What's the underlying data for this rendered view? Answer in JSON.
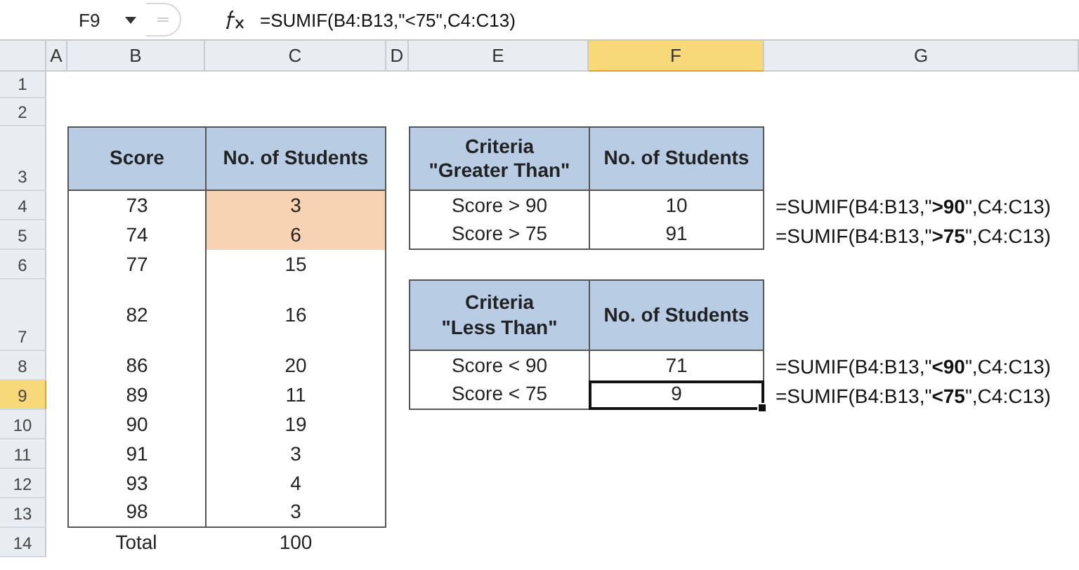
{
  "formula_bar": {
    "name_box": "F9",
    "formula": "=SUMIF(B4:B13,\"<75\",C4:C13)"
  },
  "column_headers": [
    {
      "label": "A",
      "selected": false
    },
    {
      "label": "B",
      "selected": false
    },
    {
      "label": "C",
      "selected": false
    },
    {
      "label": "D",
      "selected": false
    },
    {
      "label": "E",
      "selected": false
    },
    {
      "label": "F",
      "selected": true
    },
    {
      "label": "G",
      "selected": false
    }
  ],
  "row_headers": [
    {
      "label": "1",
      "selected": false
    },
    {
      "label": "2",
      "selected": false
    },
    {
      "label": "3",
      "selected": false
    },
    {
      "label": "4",
      "selected": false
    },
    {
      "label": "5",
      "selected": false
    },
    {
      "label": "6",
      "selected": false
    },
    {
      "label": "7",
      "selected": false
    },
    {
      "label": "8",
      "selected": false
    },
    {
      "label": "9",
      "selected": true
    },
    {
      "label": "10",
      "selected": false
    },
    {
      "label": "11",
      "selected": false
    },
    {
      "label": "12",
      "selected": false
    },
    {
      "label": "13",
      "selected": false
    },
    {
      "label": "14",
      "selected": false
    }
  ],
  "score_table": {
    "columns": [
      "Score",
      "No. of Students"
    ],
    "rows": [
      {
        "score": "73",
        "students": "3",
        "highlighted": true
      },
      {
        "score": "74",
        "students": "6",
        "highlighted": true
      },
      {
        "score": "77",
        "students": "15",
        "highlighted": false
      },
      {
        "score": "82",
        "students": "16",
        "highlighted": false
      },
      {
        "score": "86",
        "students": "20",
        "highlighted": false
      },
      {
        "score": "89",
        "students": "11",
        "highlighted": false
      },
      {
        "score": "90",
        "students": "19",
        "highlighted": false
      },
      {
        "score": "91",
        "students": "3",
        "highlighted": false
      },
      {
        "score": "93",
        "students": "4",
        "highlighted": false
      },
      {
        "score": "98",
        "students": "3",
        "highlighted": false
      }
    ],
    "total": {
      "label": "Total",
      "value": "100"
    }
  },
  "criteria_tables": [
    {
      "columns": [
        [
          "Criteria",
          "\"Greater Than\""
        ],
        [
          "No. of Students"
        ]
      ],
      "rows": [
        {
          "criteria": "Score > 90",
          "students": "10",
          "selected": false,
          "formula": "=SUMIF(B4:B13,\"**>90**\",C4:C13)"
        },
        {
          "criteria": "Score > 75",
          "students": "91",
          "selected": false,
          "formula": "=SUMIF(B4:B13,\"**>75**\",C4:C13)"
        }
      ]
    },
    {
      "columns": [
        [
          "Criteria",
          "\"Less Than\""
        ],
        [
          "No. of Students"
        ]
      ],
      "rows": [
        {
          "criteria": "Score < 90",
          "students": "71",
          "selected": false,
          "formula": "=SUMIF(B4:B13,\"**<90**\",C4:C13)"
        },
        {
          "criteria": "Score < 75",
          "students": "9",
          "selected": true,
          "formula": "=SUMIF(B4:B13,\"**<75**\",C4:C13)"
        }
      ]
    }
  ]
}
